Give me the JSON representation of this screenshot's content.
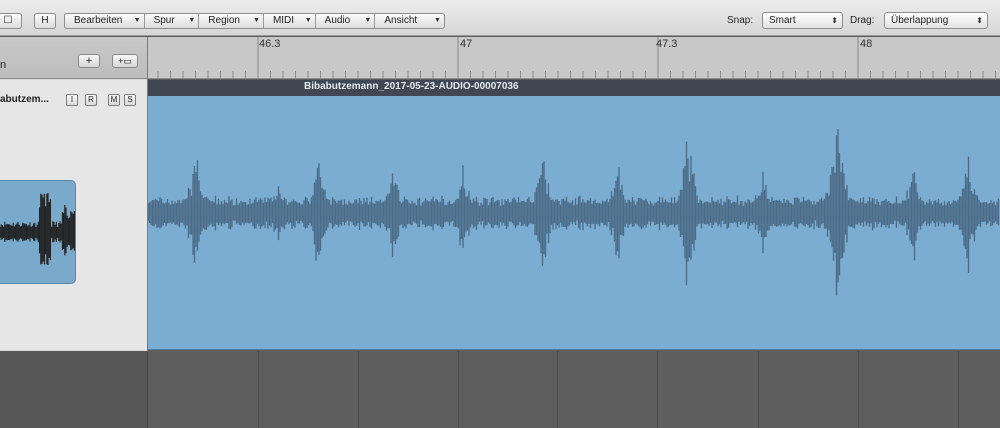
{
  "toolbar": {
    "btn_left_glyph": "☐",
    "btn_h": "H",
    "menus": [
      "Bearbeiten",
      "Spur",
      "Region",
      "MIDI",
      "Audio",
      "Ansicht"
    ],
    "snap_label": "Snap:",
    "snap_value": "Smart",
    "drag_label": "Drag:",
    "drag_value": "Überlappung"
  },
  "track_list": {
    "header_fragment": "n",
    "add_button": "+",
    "folder_button": "+▭",
    "track_name": "abutzem...",
    "track_buttons": [
      "I",
      "R",
      "M",
      "S"
    ]
  },
  "ruler": {
    "bars": [
      "46.3",
      "47",
      "47.3",
      "48"
    ]
  },
  "region": {
    "name": "Bibabutzemann_2017-05-23-AUDIO-00007036"
  },
  "colors": {
    "region_fill": "#7aadd1",
    "waveform": "#4a6a86",
    "region_header": "#3f4752"
  }
}
